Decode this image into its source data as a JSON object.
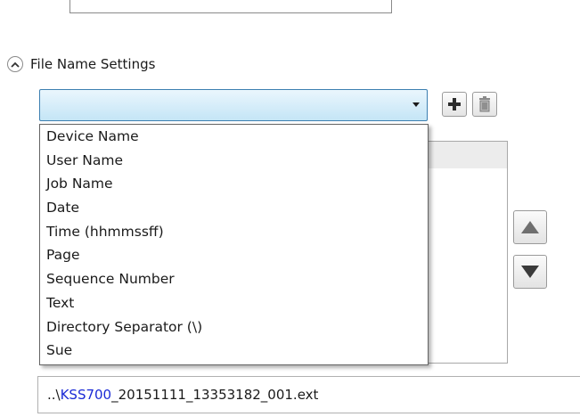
{
  "section": {
    "title": "File Name Settings"
  },
  "combo": {
    "selected": ""
  },
  "dropdown": {
    "options": [
      "Device Name",
      "User Name",
      "Job Name",
      "Date",
      "Time (hhmmssff)",
      "Page",
      "Sequence Number",
      "Text",
      "Directory Separator (\\)",
      "Sue"
    ]
  },
  "preview": {
    "prefix": "..\\",
    "device": "KSS700",
    "rest": "_20151111_13353182_001.ext"
  },
  "icons": {
    "collapse": "chevron-up-icon",
    "add": "plus-icon",
    "delete": "trash-icon",
    "move_up": "triangle-up-icon",
    "move_down": "triangle-down-icon"
  },
  "colors": {
    "combo_border": "#3c7fb1",
    "combo_fill": "#c4e5f6",
    "preview_accent": "#1b2bd6"
  }
}
